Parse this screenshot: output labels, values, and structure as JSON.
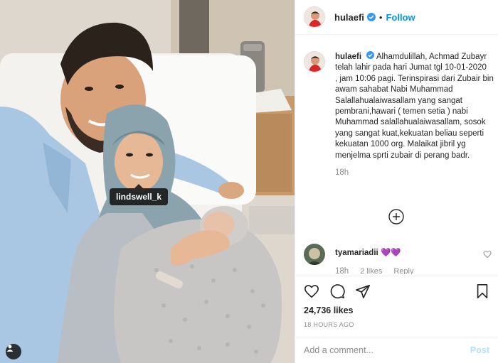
{
  "photo": {
    "tag_label": "lindswell_k"
  },
  "header": {
    "username": "hulaefi",
    "separator": "•",
    "follow_label": "Follow"
  },
  "caption": {
    "username": "hulaefi",
    "text": "Alhamdulillah, Achmad Zubayr telah lahir pada hari Jumat tgl 10-01-2020\n, jam 10:06 pagi. Terinspirasi dari Zubair bin awam sahabat Nabi Muhammad Salallahualaiwasallam yang sangat pembrani,hawari ( temen setia ) nabi Muhammad salallahualaiwasallam, sosok yang sangat kuat,kekuatan beliau seperti kekuatan 1000 org. Malaikat jibril yg menjelma sprti zubair di perang badr.",
    "time": "18h"
  },
  "comment": {
    "username": "tyamariadii",
    "text": "💜💜",
    "time": "18h",
    "likes": "2 likes",
    "reply": "Reply"
  },
  "post": {
    "likes": "24,736 likes",
    "ago": "18 HOURS AGO"
  },
  "add_comment": {
    "placeholder": "Add a comment...",
    "post_label": "Post"
  },
  "colors": {
    "accent": "#0095f6",
    "verified": "#3897f0",
    "post_disabled": "#b2dffc",
    "muted": "#8e8e8e"
  }
}
